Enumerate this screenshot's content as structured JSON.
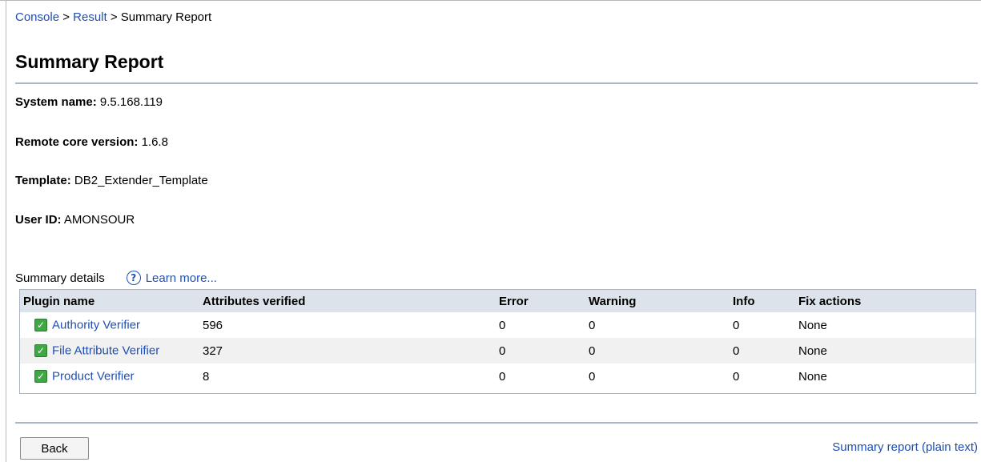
{
  "breadcrumb": {
    "console": "Console",
    "result": "Result",
    "current": "Summary Report",
    "separator": ">"
  },
  "page_title": "Summary Report",
  "fields": [
    {
      "label": "System name:",
      "value": "9.5.168.119"
    },
    {
      "label": "Remote core version:",
      "value": "1.6.8"
    },
    {
      "label": "Template:",
      "value": "DB2_Extender_Template"
    },
    {
      "label": "User ID:",
      "value": "AMONSOUR"
    }
  ],
  "summary": {
    "label": "Summary details",
    "help_icon": "question-circle-icon",
    "learn_more": "Learn more...",
    "columns": [
      "Plugin name",
      "Attributes verified",
      "Error",
      "Warning",
      "Info",
      "Fix actions"
    ],
    "rows": [
      {
        "status_icon": "check-icon",
        "plugin": "Authority Verifier",
        "attributes": "596",
        "error": "0",
        "warning": "0",
        "info": "0",
        "fix": "None"
      },
      {
        "status_icon": "check-icon",
        "plugin": "File Attribute Verifier",
        "attributes": "327",
        "error": "0",
        "warning": "0",
        "info": "0",
        "fix": "None"
      },
      {
        "status_icon": "check-icon",
        "plugin": "Product Verifier",
        "attributes": "8",
        "error": "0",
        "warning": "0",
        "info": "0",
        "fix": "None"
      }
    ]
  },
  "footer": {
    "back_label": "Back",
    "plain_text_link": "Summary report (plain text)"
  },
  "colors": {
    "link": "#1f4fb4",
    "rule": "#a8b7ca",
    "header_bg": "#dde3ea",
    "check_green": "#3fa843"
  }
}
